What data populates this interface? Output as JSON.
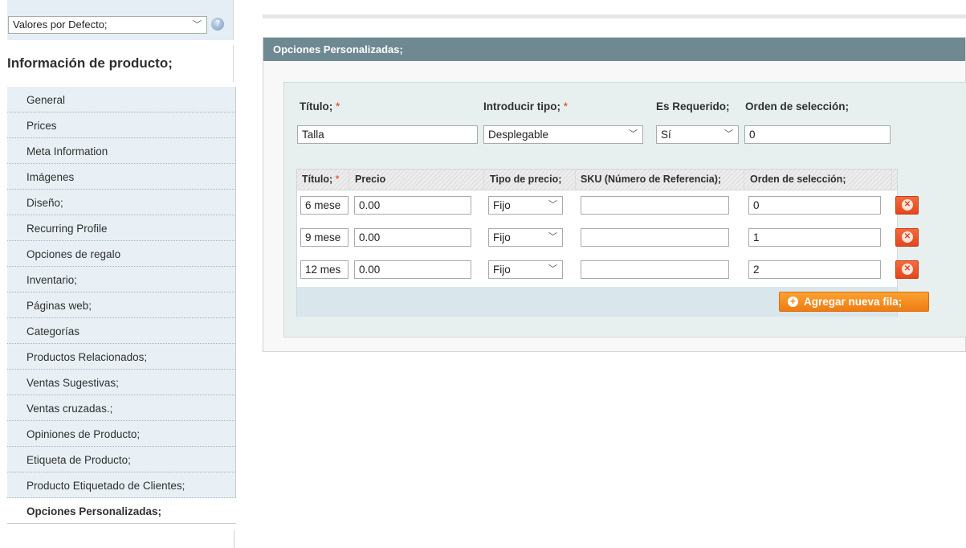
{
  "store_switcher": {
    "value": "Valores por Defecto;",
    "help_glyph": "?"
  },
  "sidebar": {
    "title": "Información de producto;",
    "items": [
      {
        "label": "General"
      },
      {
        "label": "Prices"
      },
      {
        "label": "Meta Information"
      },
      {
        "label": "Imágenes"
      },
      {
        "label": "Diseño;"
      },
      {
        "label": "Recurring Profile"
      },
      {
        "label": "Opciones de regalo"
      },
      {
        "label": "Inventario;"
      },
      {
        "label": "Páginas web;"
      },
      {
        "label": "Categorías"
      },
      {
        "label": "Productos Relacionados;"
      },
      {
        "label": "Ventas Sugestivas;"
      },
      {
        "label": "Ventas cruzadas.;"
      },
      {
        "label": "Opiniones de Producto;"
      },
      {
        "label": "Etiqueta de Producto;"
      },
      {
        "label": "Producto Etiquetado de Clientes;"
      },
      {
        "label": "Opciones Personalizadas;",
        "active": true
      }
    ]
  },
  "panel": {
    "title": "Opciones Personalizadas;",
    "option": {
      "title_label": "Título;",
      "input_type_label": "Introducir tipo;",
      "is_required_label": "Es Requerido;",
      "sort_order_label": "Orden de selección;",
      "required_mark": "*",
      "title_value": "Talla",
      "input_type_value": "Desplegable",
      "is_required_value": "Sí",
      "sort_order_value": "0"
    },
    "values_table": {
      "headers": {
        "title": "Título;",
        "price": "Precio",
        "price_type": "Tipo de precio;",
        "sku": "SKU (Número de Referencia);",
        "sort_order": "Orden de selección;"
      },
      "rows": [
        {
          "title": "6 mese",
          "price": "0.00",
          "price_type": "Fijo",
          "sku": "",
          "sort_order": "0"
        },
        {
          "title": "9 mese",
          "price": "0.00",
          "price_type": "Fijo",
          "sku": "",
          "sort_order": "1"
        },
        {
          "title": "12 mes",
          "price": "0.00",
          "price_type": "Fijo",
          "sku": "",
          "sort_order": "2"
        }
      ],
      "delete_glyph": "✕",
      "add_row_label": "Agregar nueva fila;",
      "add_glyph": "+"
    }
  },
  "colors": {
    "header_bar": "#6f8992",
    "sidebar_bg": "#e8f0f5",
    "option_box": "#e7efef",
    "button_orange": "#ef7c13",
    "delete_red": "#e4461c",
    "required_red": "#eb340a"
  },
  "icons": {
    "select_arrow": "chevron-down-icon",
    "help": "help-icon",
    "delete": "delete-row-icon",
    "add": "plus-icon"
  }
}
